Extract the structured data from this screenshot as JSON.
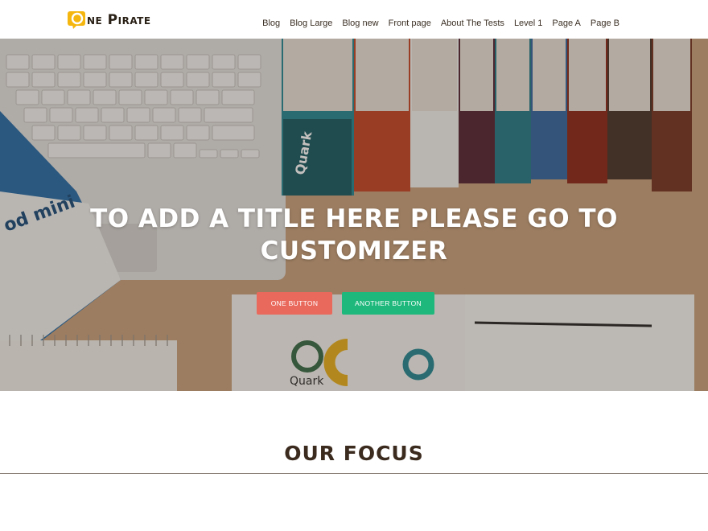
{
  "site": {
    "logo_text": "ne Pirate",
    "logo_icon": "speech-bubble-o-icon",
    "brand_color": "#f5b70f"
  },
  "nav": {
    "items": [
      {
        "label": "Blog"
      },
      {
        "label": "Blog Large"
      },
      {
        "label": "Blog new"
      },
      {
        "label": "Front page"
      },
      {
        "label": "About The Tests"
      },
      {
        "label": "Level 1"
      },
      {
        "label": "Page A"
      },
      {
        "label": "Page B"
      }
    ]
  },
  "hero": {
    "title": "TO ADD A TITLE HERE PLEASE GO TO CUSTOMIZER",
    "primary_button": "ONE BUTTON",
    "secondary_button": "ANOTHER BUTTON",
    "primary_color": "#e9695c",
    "secondary_color": "#1fb87c",
    "background_image": {
      "description_icons": [
        "laptop-keyboard",
        "books",
        "magazine",
        "notepad",
        "open-book"
      ],
      "book_text": "Quark",
      "magazine_text": "od mini"
    }
  },
  "focus": {
    "title": "OUR FOCUS"
  }
}
